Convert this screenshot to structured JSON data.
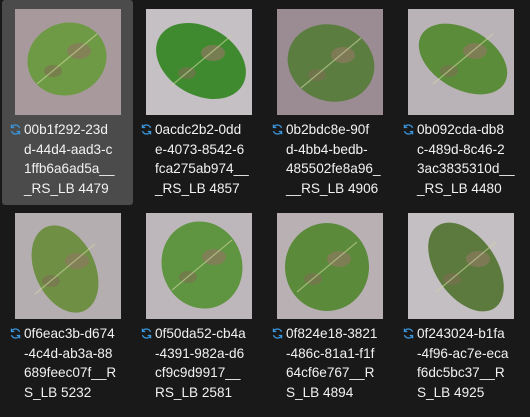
{
  "colors": {
    "selection": "#4b4b4b",
    "sync_icon": "#3a96dd",
    "background": "#191919"
  },
  "files": [
    {
      "lines": [
        "00b1f292-23d",
        "d-44d4-aad3-c",
        "1ffb6a6ad5a__",
        "_RS_LB 4479"
      ],
      "selected": true,
      "status_icon": "sync-icon"
    },
    {
      "lines": [
        "0acdc2b2-0dd",
        "e-4073-8542-6",
        "fca275ab974__",
        "_RS_LB 4857"
      ],
      "selected": false,
      "status_icon": "sync-icon"
    },
    {
      "lines": [
        "0b2bdc8e-90f",
        "d-4bb4-bedb-",
        "485502fe8a96_",
        "__RS_LB 4906"
      ],
      "selected": false,
      "status_icon": "sync-icon"
    },
    {
      "lines": [
        "0b092cda-db8",
        "c-489d-8c46-2",
        "3ac3835310d__",
        "_RS_LB 4480"
      ],
      "selected": false,
      "status_icon": "sync-icon"
    },
    {
      "lines": [
        "0f6eac3b-d674",
        "-4c4d-ab3a-88",
        "689feec07f__R",
        "S_LB 5232"
      ],
      "selected": false,
      "status_icon": "sync-icon"
    },
    {
      "lines": [
        "0f50da52-cb4a",
        "-4391-982a-d6",
        "cf9c9d9917__",
        "RS_LB 2581"
      ],
      "selected": false,
      "status_icon": "sync-icon"
    },
    {
      "lines": [
        "0f824e18-3821",
        "-486c-81a1-f1f",
        "64cf6e767__R",
        "S_LB 4894"
      ],
      "selected": false,
      "status_icon": "sync-icon"
    },
    {
      "lines": [
        "0f243024-b1fa",
        "-4f96-ac7e-eca",
        "f6dc5bc37__R",
        "S_LB 4925"
      ],
      "selected": false,
      "status_icon": "sync-icon"
    }
  ]
}
